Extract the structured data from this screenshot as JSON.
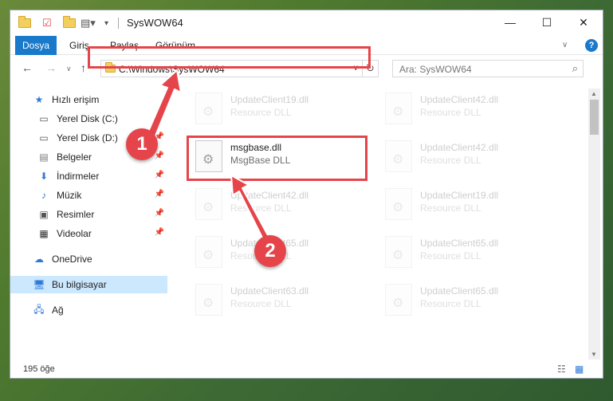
{
  "window": {
    "title": "SysWOW64"
  },
  "ribbon": {
    "tabs": [
      "Dosya",
      "Giriş",
      "Paylaş",
      "Görünüm"
    ],
    "help": "?"
  },
  "address": {
    "path": "C:\\Windows\\SysWOW64",
    "search_placeholder": "Ara: SysWOW64"
  },
  "sidebar": {
    "items": [
      {
        "label": "Hızlı erişim",
        "icon": "star-icon"
      },
      {
        "label": "Yerel Disk (C:)",
        "icon": "drive-icon"
      },
      {
        "label": "Yerel Disk (D:)",
        "icon": "drive-icon"
      },
      {
        "label": "Belgeler",
        "icon": "document-icon"
      },
      {
        "label": "İndirmeler",
        "icon": "download-icon"
      },
      {
        "label": "Müzik",
        "icon": "music-icon"
      },
      {
        "label": "Resimler",
        "icon": "picture-icon"
      },
      {
        "label": "Videolar",
        "icon": "video-icon"
      },
      {
        "label": "OneDrive",
        "icon": "cloud-icon"
      },
      {
        "label": "Bu bilgisayar",
        "icon": "computer-icon"
      },
      {
        "label": "Ağ",
        "icon": "network-icon"
      }
    ]
  },
  "files": {
    "left": [
      {
        "name": "UpdateClient19.dll",
        "desc": "Resource DLL"
      },
      {
        "name": "msgbase.dll",
        "desc": "MsgBase DLL"
      },
      {
        "name": "UpdateClient42.dll",
        "desc": "Resource DLL"
      },
      {
        "name": "UpdateClient65.dll",
        "desc": "Resource DLL"
      },
      {
        "name": "UpdateClient63.dll",
        "desc": "Resource DLL"
      }
    ],
    "right": [
      {
        "name": "UpdateClient42.dll",
        "desc": "Resource DLL"
      },
      {
        "name": "UpdateClient42.dll",
        "desc": "Resource DLL"
      },
      {
        "name": "UpdateClient19.dll",
        "desc": "Resource DLL"
      },
      {
        "name": "UpdateClient65.dll",
        "desc": "Resource DLL"
      },
      {
        "name": "UpdateClient65.dll",
        "desc": "Resource DLL"
      }
    ]
  },
  "status": {
    "count": "195 öğe"
  },
  "annotations": {
    "step1": "1",
    "step2": "2",
    "color": "#e5454a"
  },
  "colors": {
    "accent": "#1979ca",
    "highlight": "#e5454a",
    "selected": "#cce8ff"
  }
}
